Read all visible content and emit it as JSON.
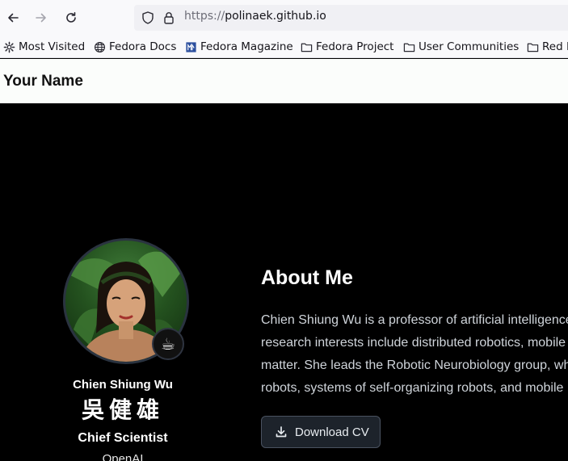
{
  "browser": {
    "url_scheme": "https://",
    "url_host": "polinaek.github.io",
    "bookmarks": [
      {
        "label": "Most Visited",
        "icon": "gear-icon"
      },
      {
        "label": "Fedora Docs",
        "icon": "globe-icon"
      },
      {
        "label": "Fedora Magazine",
        "icon": "fedora-magazine-icon"
      },
      {
        "label": "Fedora Project",
        "icon": "folder-icon"
      },
      {
        "label": "User Communities",
        "icon": "folder-icon"
      },
      {
        "label": "Red Hat",
        "icon": "folder-icon"
      }
    ]
  },
  "site": {
    "title": "Your Name"
  },
  "profile": {
    "name_en": "Chien Shiung Wu",
    "name_zh": "吳健雄",
    "role": "Chief Scientist",
    "org": "OpenAI",
    "badge_icon": "coffee-icon",
    "badge_glyph": "☕"
  },
  "about": {
    "title": "About Me",
    "lines": [
      "Chien Shiung Wu is a professor of artificial intelligence",
      "research interests include distributed robotics, mobile",
      "matter. She leads the Robotic Neurobiology group, which",
      "robots, systems of self-organizing robots, and mobile"
    ],
    "cv_button": "Download CV"
  },
  "colors": {
    "page_bg": "#000000",
    "header_bg": "#fbfdfb",
    "button_bg": "#1d232b"
  }
}
